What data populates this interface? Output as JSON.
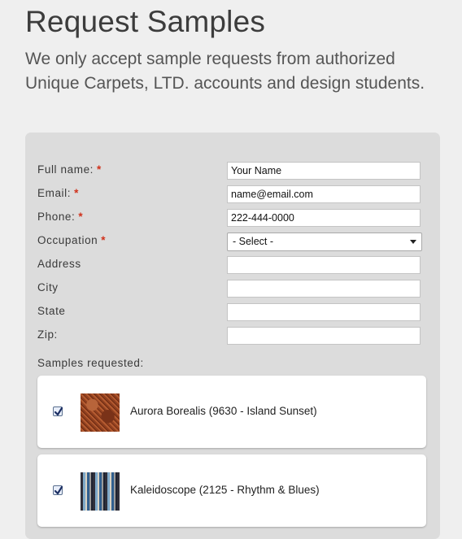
{
  "header": {
    "title": "Request Samples",
    "intro": "We only accept sample requests from authorized Unique Carpets, LTD. accounts and design students."
  },
  "form": {
    "required_marker": "*",
    "fields": [
      {
        "label": "Full name:",
        "required": true,
        "value": "Your Name"
      },
      {
        "label": "Email:",
        "required": true,
        "value": "name@email.com"
      },
      {
        "label": "Phone:",
        "required": true,
        "value": "222-444-0000"
      },
      {
        "label": "Occupation",
        "required": true,
        "selected": "- Select -"
      },
      {
        "label": "Address",
        "required": false,
        "value": ""
      },
      {
        "label": "City",
        "required": false,
        "value": ""
      },
      {
        "label": "State",
        "required": false,
        "value": ""
      },
      {
        "label": "Zip:",
        "required": false,
        "value": ""
      }
    ],
    "samples_label": "Samples requested:",
    "samples": [
      {
        "name": "Aurora Borealis (9630 - Island Sunset)",
        "checked": true
      },
      {
        "name": "Kaleidoscope (2125 - Rhythm & Blues)",
        "checked": true
      }
    ]
  },
  "colors": {
    "required_asterisk": "#d0311b",
    "panel_background": "#dcdcdc",
    "page_background": "#efefef"
  },
  "icons": {
    "select_arrow": "chevron-down-icon",
    "checkbox_mark": "checkmark-icon"
  }
}
